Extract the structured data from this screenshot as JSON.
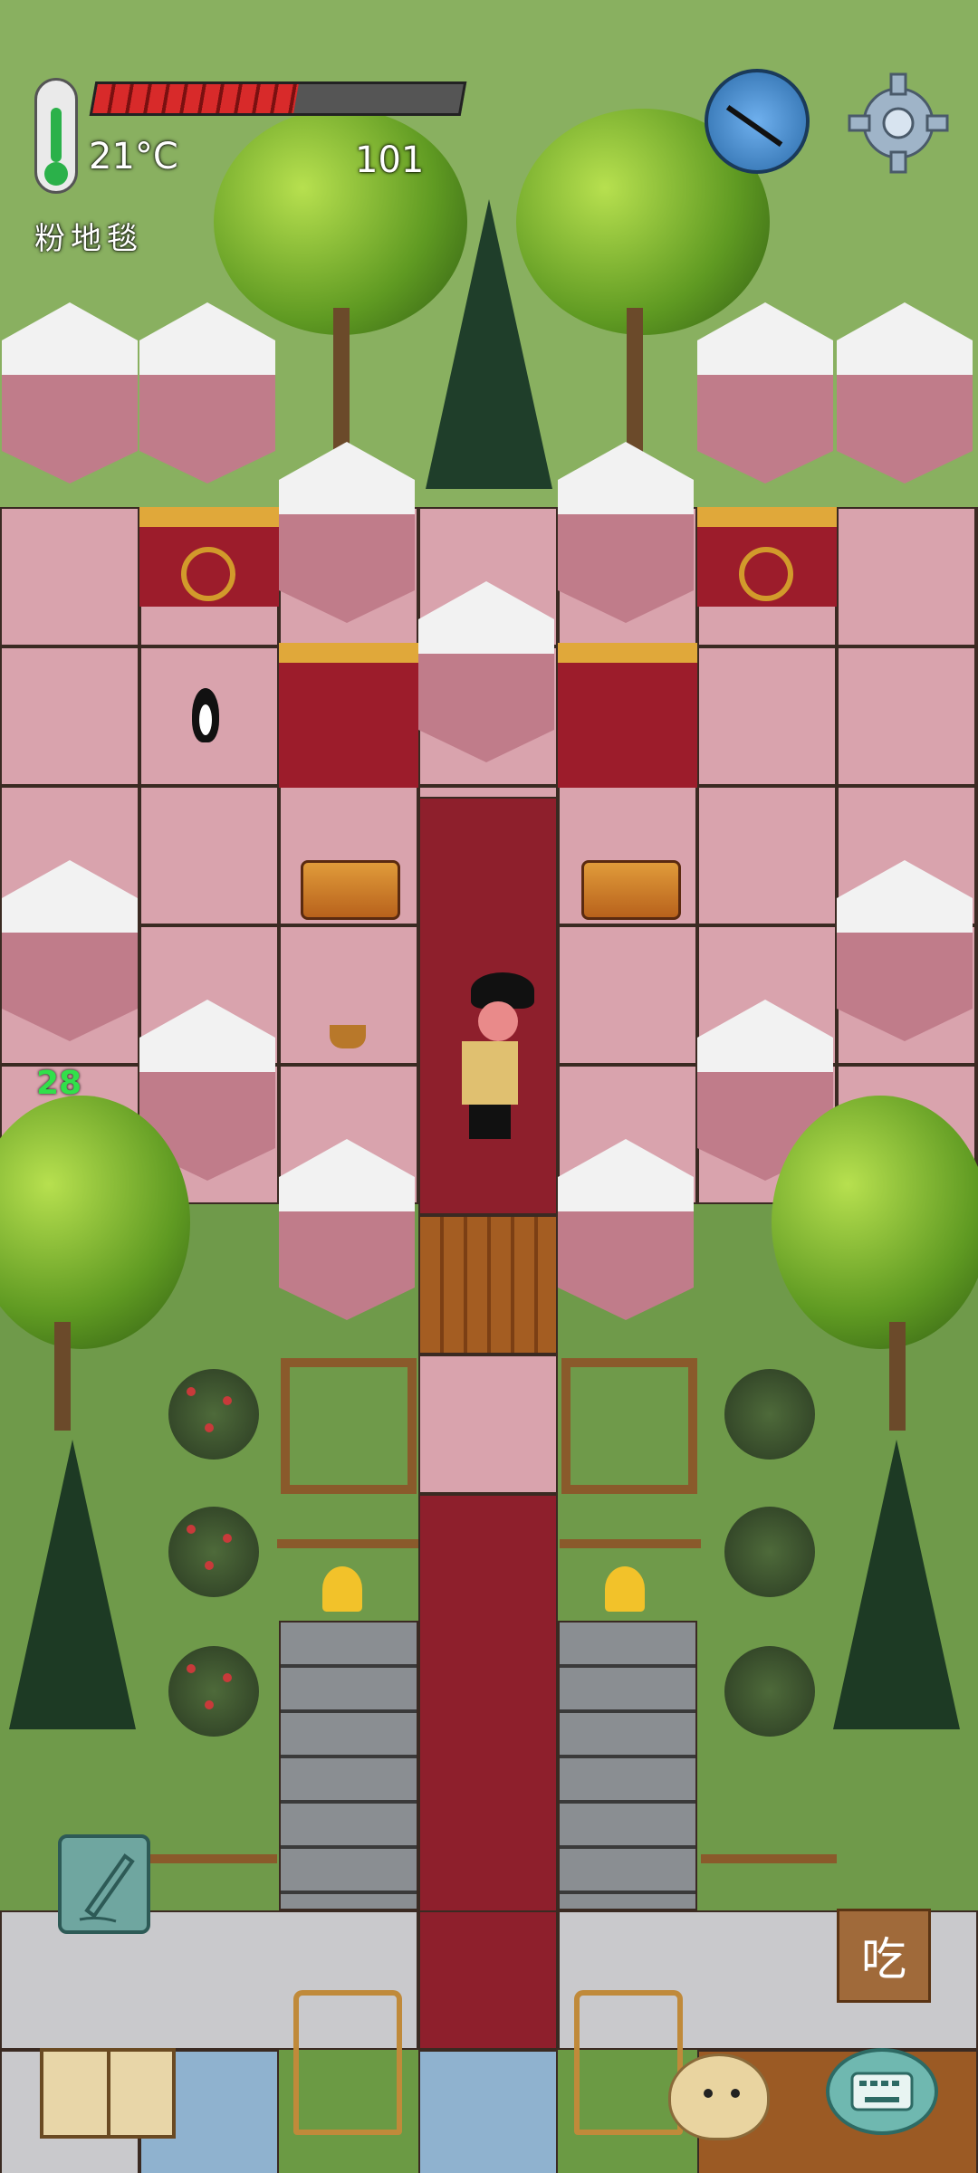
{
  "hud": {
    "temperature": "21°C",
    "location": "粉地毯",
    "counter": "101",
    "level_number": "28",
    "health_fraction": 0.55,
    "eat_label": "吃"
  },
  "icons": {
    "thermometer": "thermometer-icon",
    "health_bar": "health-bar",
    "compass": "compass-icon",
    "settings": "gear-icon",
    "pencil": "pencil-icon",
    "eat": "eat-button",
    "book": "book-icon",
    "avatar": "avatar-icon",
    "keyboard": "keyboard-icon"
  },
  "colors": {
    "temperature_green": "#2bb14a",
    "health_red": "#d82a2a",
    "carpet_pink": "#d9a3ad",
    "carpet_red": "#8e1f2c"
  }
}
